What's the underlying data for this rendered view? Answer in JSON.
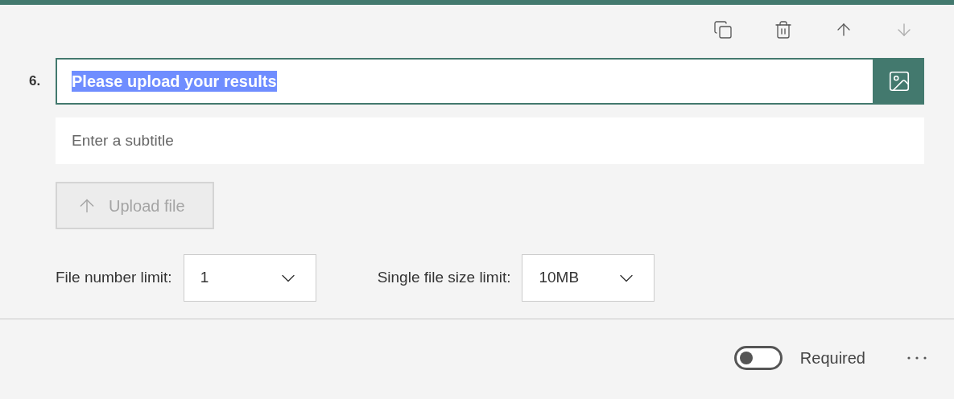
{
  "toolbar": [
    {
      "kind": "copy",
      "disabled": false
    },
    {
      "kind": "delete",
      "disabled": false
    },
    {
      "kind": "move-up",
      "disabled": false
    },
    {
      "kind": "move-down",
      "disabled": true
    }
  ],
  "question": {
    "number": "6.",
    "title": "Please upload your results",
    "subtitle_placeholder": "Enter a subtitle"
  },
  "upload_button": {
    "label": "Upload file",
    "disabled": true
  },
  "limits": [
    {
      "label": "File number limit:",
      "value": "1"
    },
    {
      "label": "Single file size limit:",
      "value": "10MB"
    }
  ],
  "footer": {
    "required": {
      "label": "Required",
      "on": false
    }
  }
}
